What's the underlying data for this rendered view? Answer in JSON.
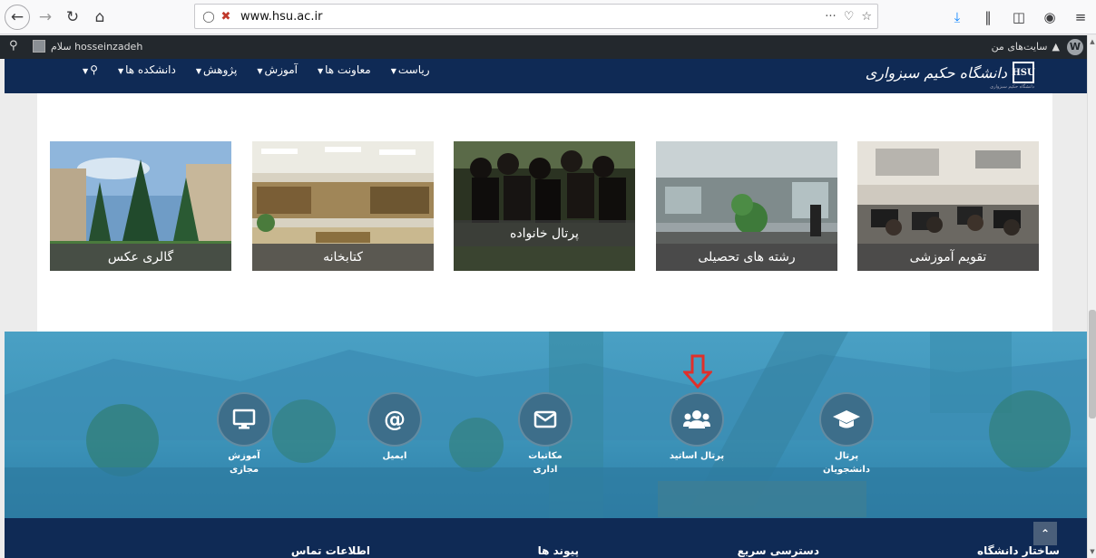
{
  "browser": {
    "url_host": "www.hsu.ac.ir",
    "url_scheme": "",
    "page_actions": "···"
  },
  "adminbar": {
    "my_sites": "سایت‌های من",
    "greeting": "سلام hosseinzadeh"
  },
  "header": {
    "logo_text": "دانشگاه حکیم سبزواری",
    "logo_tagline": "دانشگاه حکیم سبزواری",
    "menu": [
      {
        "label": "ریاست"
      },
      {
        "label": "معاونت ها"
      },
      {
        "label": "آموزش"
      },
      {
        "label": "پژوهش"
      },
      {
        "label": "دانشکده ها"
      },
      {
        "label": ""
      }
    ]
  },
  "tiles": [
    {
      "label": "تقویم آموزشی"
    },
    {
      "label": "رشته های تحصیلی"
    },
    {
      "label": "پرتال خانواده"
    },
    {
      "label": "کتابخانه"
    },
    {
      "label": "گالری عکس"
    }
  ],
  "quick_links": [
    {
      "label_line1": "پرتال",
      "label_line2": "دانشجویان",
      "icon": "graduation-cap-icon"
    },
    {
      "label_line1": "پرتال اساتید",
      "label_line2": "",
      "icon": "users-icon"
    },
    {
      "label_line1": "مکاتبات",
      "label_line2": "اداری",
      "icon": "envelope-icon"
    },
    {
      "label_line1": "ایمیل",
      "label_line2": "",
      "icon": "at-icon"
    },
    {
      "label_line1": "آموزش",
      "label_line2": "مجازی",
      "icon": "monitor-icon"
    }
  ],
  "footer": {
    "headings": [
      "ساختار دانشگاه",
      "دسترسی سریع",
      "پیوند ها",
      "اطلاعات تماس"
    ]
  },
  "colors": {
    "navy": "#0f2a55",
    "hero_blue": "#3d94b9",
    "circle": "#3d6e8a",
    "arrow_red": "#e0302a"
  }
}
